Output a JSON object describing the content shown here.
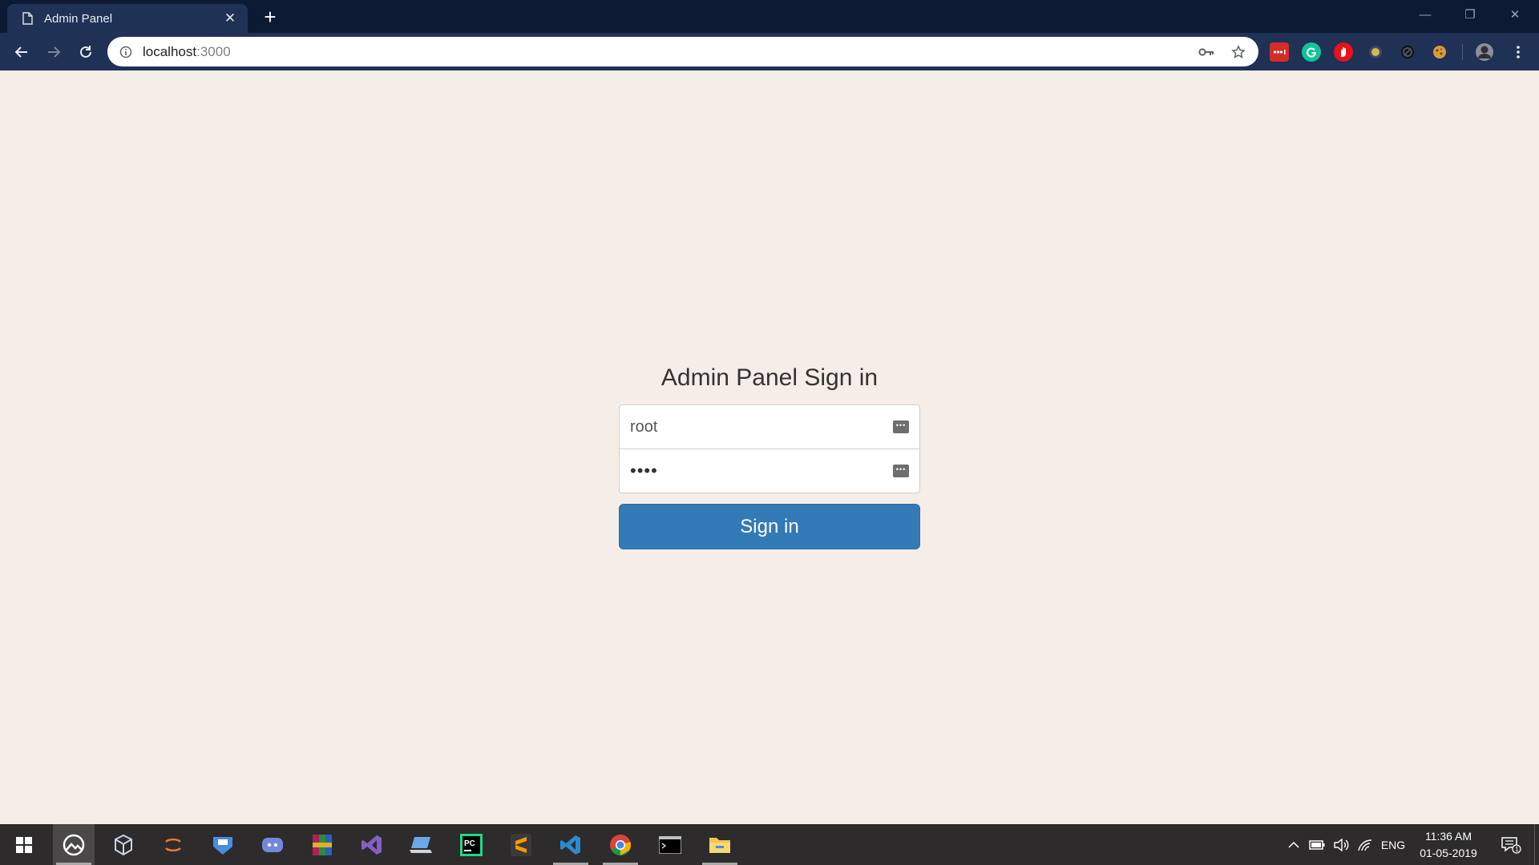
{
  "browser": {
    "tab_title": "Admin Panel",
    "tab_close": "✕",
    "new_tab": "+",
    "url_host": "localhost",
    "url_port": ":3000",
    "window_controls": {
      "minimize": "—",
      "restore": "❐",
      "close": "✕"
    },
    "icons": [
      "back-arrow-icon",
      "forward-arrow-icon",
      "reload-icon",
      "info-icon",
      "key-icon",
      "star-icon",
      "menu-dots-icon"
    ],
    "extensions": [
      {
        "name": "lastpass-extension",
        "color": "#d32d27"
      },
      {
        "name": "grammarly-extension",
        "color": "#15c39a"
      },
      {
        "name": "adblock-extension",
        "color": "#e8121c"
      },
      {
        "name": "lightbulb-extension",
        "color": "#d8b84a"
      },
      {
        "name": "circle-extension",
        "color": "#111111"
      },
      {
        "name": "cookie-extension",
        "color": "#d99a3e"
      }
    ]
  },
  "login": {
    "title": "Admin Panel Sign in",
    "username_value": "root",
    "password_value": "••••",
    "submit_label": "Sign in",
    "accent_color": "#337ab7"
  },
  "taskbar": {
    "apps": [
      "start-button",
      "photos-app",
      "virtualbox-app",
      "jupyter-app",
      "remote-app",
      "discord-app",
      "winrar-app",
      "visual-studio-app",
      "laptop-app",
      "pycharm-app",
      "sublime-app",
      "vscode-app",
      "chrome-app",
      "terminal-app",
      "file-explorer-app"
    ],
    "language": "ENG",
    "time": "11:36 AM",
    "date": "01-05-2019",
    "notification_count": "1"
  }
}
